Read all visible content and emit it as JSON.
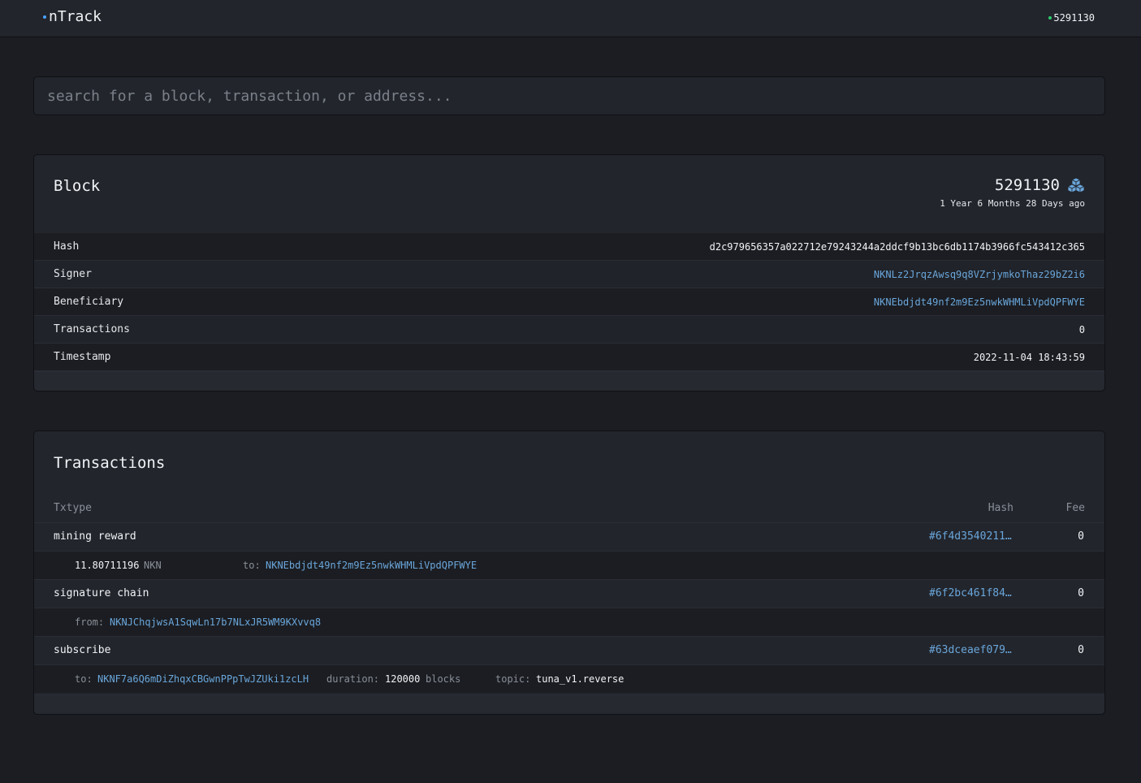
{
  "header": {
    "brand": "nTrack",
    "latest_block": "5291130"
  },
  "search": {
    "placeholder": "search for a block, transaction, or address..."
  },
  "block": {
    "title": "Block",
    "number": "5291130",
    "age": "1 Year 6 Months 28 Days ago",
    "fields": [
      {
        "key": "Hash",
        "value": "d2c979656357a022712e79243244a2ddcf9b13bc6db1174b3966fc543412c365"
      },
      {
        "key": "Signer",
        "value": "NKNLz2JrqzAwsq9q8VZrjymkoThaz29bZ2i6"
      },
      {
        "key": "Beneficiary",
        "value": "NKNEbdjdt49nf2m9Ez5nwkWHMLiVpdQPFWYE"
      },
      {
        "key": "Transactions",
        "value": "0"
      },
      {
        "key": "Timestamp",
        "value": "2022-11-04 18:43:59"
      }
    ]
  },
  "transactions": {
    "title": "Transactions",
    "columns": {
      "type": "Txtype",
      "hash": "Hash",
      "fee": "Fee"
    },
    "items": [
      {
        "type": "mining reward",
        "hash": "#6f4d3540211...",
        "fee": "0",
        "amount": "11.80711196",
        "unit": "NKN",
        "to_label": "to:",
        "to": "NKNEbdjdt49nf2m9Ez5nwkWHMLiVpdQPFWYE"
      },
      {
        "type": "signature chain",
        "hash": "#6f2bc461f84...",
        "fee": "0",
        "from_label": "from:",
        "from": "NKNJChqjwsA1SqwLn17b7NLxJR5WM9KXvvq8"
      },
      {
        "type": "subscribe",
        "hash": "#63dceaef079...",
        "fee": "0",
        "to_label": "to:",
        "to": "NKNF7a6Q6mDiZhqxCBGwnPPpTwJZUki1zcLH",
        "duration_label": "duration:",
        "duration": "120000",
        "duration_unit": "blocks",
        "topic_label": "topic:",
        "topic": "tuna_v1.reverse"
      }
    ]
  },
  "colors": {
    "background": "#1b1d23",
    "panel": "#22252c",
    "link": "#6aa6da",
    "status_dot": "#2ecc71",
    "brand_dot": "#4aa3ff"
  }
}
